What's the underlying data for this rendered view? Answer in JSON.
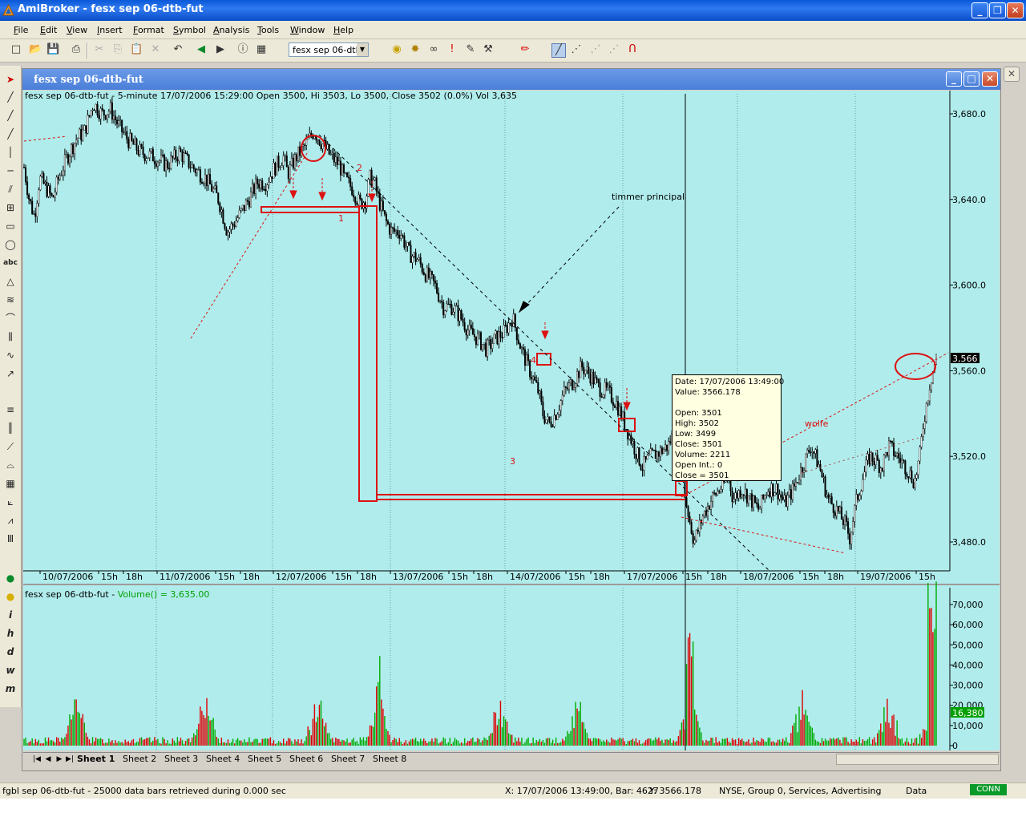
{
  "window": {
    "title": "AmiBroker - fesx sep 06-dtb-fut"
  },
  "menu": [
    "File",
    "Edit",
    "View",
    "Insert",
    "Format",
    "Symbol",
    "Analysis",
    "Tools",
    "Window",
    "Help"
  ],
  "toolbar": {
    "symbol": "fesx sep 06-dtb-"
  },
  "child": {
    "title": "fesx sep 06-dtb-fut"
  },
  "price_pane": {
    "header": "fesx sep 06-dtb-fut - 5-minute 17/07/2006 15:29:00 Open 3500, Hi 3503, Lo 3500, Close 3502 (0.0%) Vol 3,635",
    "last_price": "3,566"
  },
  "volume_pane": {
    "header_prefix": "fesx sep 06-dtb-fut - ",
    "header_func": "Volume() = 3,635.00",
    "last_volume": "16,380"
  },
  "annotations": {
    "timmer": "timmer principal",
    "wolfe": "wolfe",
    "n1": "1",
    "n2": "2",
    "n3": "3",
    "n4": "4"
  },
  "tooltip": {
    "lines": [
      "Date: 17/07/2006 13:49:00",
      "Value: 3566.178",
      "",
      "Open: 3501",
      "High:  3502",
      "Low:   3499",
      "Close: 3501",
      "Volume: 2211",
      "Open Int.: 0",
      "Close = 3501"
    ]
  },
  "sheets": [
    "Sheet 1",
    "Sheet 2",
    "Sheet 3",
    "Sheet 4",
    "Sheet 5",
    "Sheet 6",
    "Sheet 7",
    "Sheet 8"
  ],
  "status": {
    "left": "fgbl sep 06-dtb-fut - 25000 data bars retrieved during 0.000 sec",
    "coords": "X: 17/07/2006 13:49:00, Bar: 4627",
    "y": "Y: 3566.178",
    "market": "NYSE, Group 0, Services, Advertising",
    "data": "Data",
    "conn": "CONN"
  },
  "colors": {
    "chart_bg": "#b0ecec",
    "up": "#00aa00",
    "down": "#dd0000",
    "annot": "#dd1111"
  },
  "chart_data": [
    {
      "type": "candlestick",
      "title": "fesx sep 06-dtb-fut - 5-minute",
      "y_ticks": [
        3480,
        3520,
        3560,
        3600,
        3640,
        3680
      ],
      "y_tick_labels": [
        "3,480.0",
        "3,520.0",
        "3,560.0",
        "3,600.0",
        "3,640.0",
        "3,680.0"
      ],
      "ylim": [
        3468,
        3692
      ],
      "x_tick_labels": [
        "10/07/2006",
        "15h",
        "18h",
        "11/07/2006",
        "15h",
        "18h",
        "12/07/2006",
        "15h",
        "18h",
        "13/07/2006",
        "15h",
        "18h",
        "14/07/2006",
        "15h",
        "18h",
        "17/07/2006",
        "15h",
        "18h",
        "18/07/2006",
        "15h",
        "18h",
        "19/07/2006",
        "15h"
      ],
      "price_path": [
        [
          0,
          3655
        ],
        [
          0.006,
          3640
        ],
        [
          0.012,
          3632
        ],
        [
          0.018,
          3650
        ],
        [
          0.026,
          3645
        ],
        [
          0.033,
          3640
        ],
        [
          0.04,
          3650
        ],
        [
          0.05,
          3660
        ],
        [
          0.06,
          3668
        ],
        [
          0.07,
          3672
        ],
        [
          0.08,
          3685
        ],
        [
          0.09,
          3680
        ],
        [
          0.1,
          3682
        ],
        [
          0.11,
          3674
        ],
        [
          0.12,
          3668
        ],
        [
          0.135,
          3662
        ],
        [
          0.15,
          3660
        ],
        [
          0.165,
          3656
        ],
        [
          0.18,
          3662
        ],
        [
          0.195,
          3655
        ],
        [
          0.21,
          3650
        ],
        [
          0.225,
          3640
        ],
        [
          0.235,
          3625
        ],
        [
          0.245,
          3630
        ],
        [
          0.26,
          3640
        ],
        [
          0.27,
          3648
        ],
        [
          0.28,
          3648
        ],
        [
          0.29,
          3655
        ],
        [
          0.3,
          3660
        ],
        [
          0.305,
          3652
        ],
        [
          0.315,
          3660
        ],
        [
          0.325,
          3665
        ],
        [
          0.335,
          3672
        ],
        [
          0.345,
          3666
        ],
        [
          0.355,
          3660
        ],
        [
          0.365,
          3656
        ],
        [
          0.37,
          3650
        ],
        [
          0.38,
          3645
        ],
        [
          0.388,
          3638
        ],
        [
          0.395,
          3640
        ],
        [
          0.4,
          3650
        ],
        [
          0.405,
          3648
        ],
        [
          0.41,
          3640
        ],
        [
          0.418,
          3630
        ],
        [
          0.425,
          3625
        ],
        [
          0.435,
          3625
        ],
        [
          0.445,
          3615
        ],
        [
          0.455,
          3612
        ],
        [
          0.465,
          3605
        ],
        [
          0.475,
          3600
        ],
        [
          0.485,
          3590
        ],
        [
          0.495,
          3590
        ],
        [
          0.505,
          3585
        ],
        [
          0.515,
          3578
        ],
        [
          0.525,
          3575
        ],
        [
          0.535,
          3570
        ],
        [
          0.545,
          3575
        ],
        [
          0.555,
          3578
        ],
        [
          0.565,
          3585
        ],
        [
          0.575,
          3570
        ],
        [
          0.585,
          3560
        ],
        [
          0.595,
          3550
        ],
        [
          0.6,
          3540
        ],
        [
          0.607,
          3535
        ],
        [
          0.615,
          3540
        ],
        [
          0.625,
          3550
        ],
        [
          0.635,
          3555
        ],
        [
          0.645,
          3562
        ],
        [
          0.655,
          3558
        ],
        [
          0.665,
          3552
        ],
        [
          0.675,
          3550
        ],
        [
          0.685,
          3545
        ],
        [
          0.695,
          3535
        ],
        [
          0.705,
          3525
        ],
        [
          0.715,
          3515
        ],
        [
          0.725,
          3520
        ],
        [
          0.735,
          3522
        ],
        [
          0.745,
          3525
        ],
        [
          0.752,
          3532
        ],
        [
          0.758,
          3525
        ],
        [
          0.765,
          3500
        ],
        [
          0.775,
          3480
        ],
        [
          0.785,
          3492
        ],
        [
          0.795,
          3500
        ],
        [
          0.805,
          3505
        ],
        [
          0.815,
          3510
        ],
        [
          0.82,
          3500
        ],
        [
          0.83,
          3505
        ],
        [
          0.84,
          3500
        ],
        [
          0.85,
          3495
        ],
        [
          0.86,
          3505
        ],
        [
          0.87,
          3505
        ],
        [
          0.88,
          3498
        ],
        [
          0.89,
          3505
        ],
        [
          0.9,
          3515
        ],
        [
          0.91,
          3525
        ],
        [
          0.92,
          3515
        ],
        [
          0.93,
          3500
        ],
        [
          0.94,
          3495
        ],
        [
          0.95,
          3488
        ],
        [
          0.955,
          3482
        ],
        [
          0.962,
          3498
        ],
        [
          0.97,
          3510
        ],
        [
          0.978,
          3520
        ],
        [
          0.985,
          3518
        ],
        [
          0.992,
          3515
        ],
        [
          1,
          3525
        ],
        [
          1.01,
          3520
        ],
        [
          1.02,
          3515
        ],
        [
          1.03,
          3508
        ],
        [
          1.036,
          3520
        ],
        [
          1.04,
          3535
        ],
        [
          1.048,
          3555
        ],
        [
          1.055,
          3566
        ]
      ]
    },
    {
      "type": "bar",
      "title": "Volume",
      "y_tick_labels": [
        "70,000",
        "60,000",
        "50,000",
        "40,000",
        "30,000",
        "20,000",
        "10,000",
        "0"
      ],
      "ylim": [
        0,
        75000
      ]
    }
  ]
}
